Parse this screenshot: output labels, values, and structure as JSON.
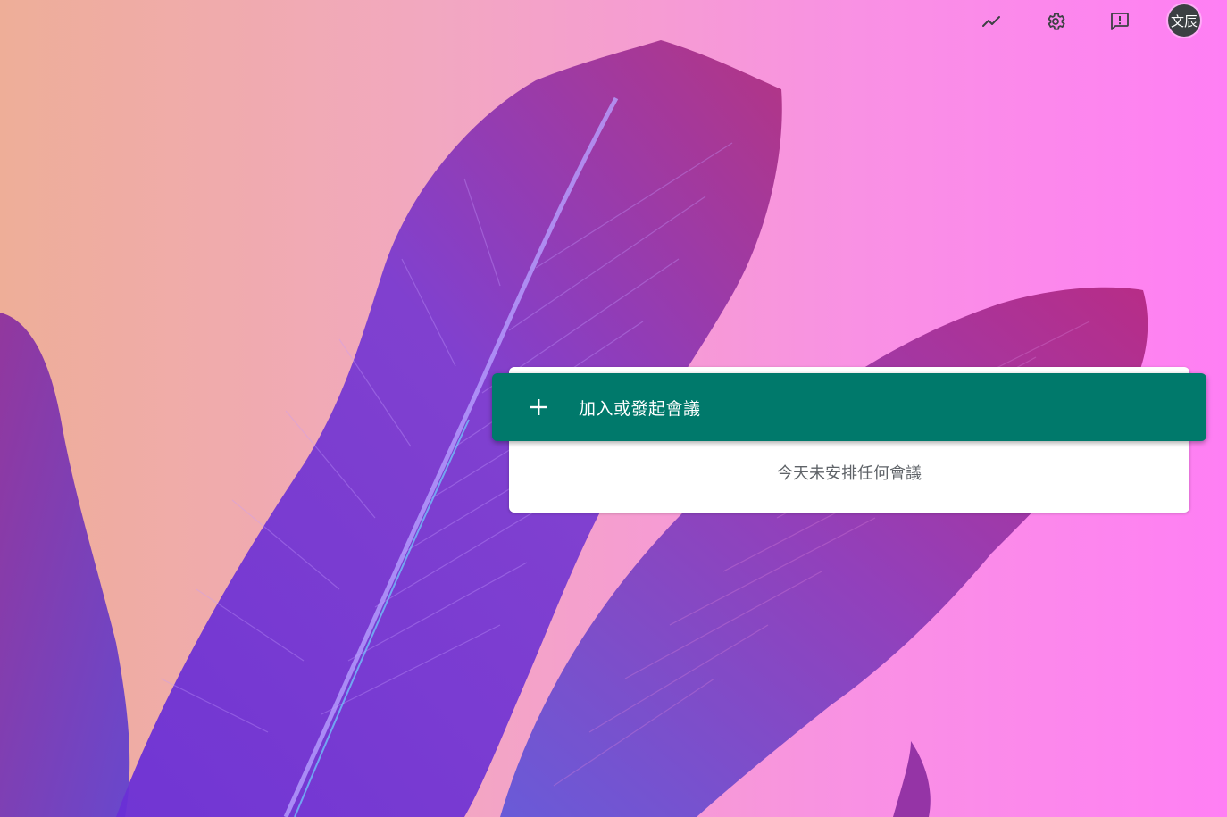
{
  "topbar": {
    "icons": [
      {
        "name": "trending-up-icon"
      },
      {
        "name": "settings-gear-icon"
      },
      {
        "name": "feedback-icon"
      }
    ],
    "avatar_label": "文辰",
    "icon_color": "#3c4043"
  },
  "meeting": {
    "join_label": "加入或發起會議",
    "join_icon": "plus-icon",
    "empty_message": "今天未安排任何會議",
    "accent_color": "#00796b"
  }
}
